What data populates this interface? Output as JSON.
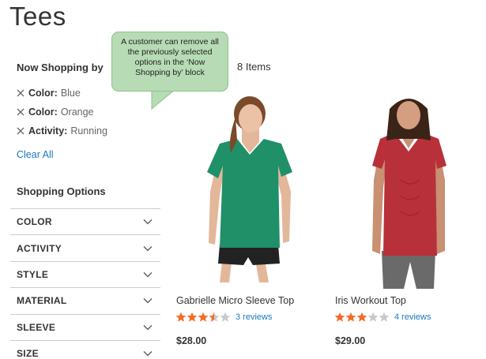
{
  "page": {
    "title": "Tees"
  },
  "now_shopping": {
    "title": "Now Shopping by",
    "filters": [
      {
        "name": "Color:",
        "value": "Blue"
      },
      {
        "name": "Color:",
        "value": "Orange"
      },
      {
        "name": "Activity:",
        "value": "Running"
      }
    ],
    "clear_all": "Clear All"
  },
  "shopping_options": {
    "title": "Shopping Options",
    "items": [
      "COLOR",
      "ACTIVITY",
      "STYLE",
      "MATERIAL",
      "SLEEVE",
      "SIZE"
    ]
  },
  "toolbar": {
    "count": "8 Items"
  },
  "callout": {
    "text": "A customer can remove all the previously selected options in the ‘Now Shopping by’ block"
  },
  "products": [
    {
      "name": "Gabrielle Micro Sleeve Top",
      "rating": 3.5,
      "reviews": "3 reviews",
      "price": "$28.00",
      "shirt_color": "#1f9068"
    },
    {
      "name": "Iris Workout Top",
      "rating": 3,
      "reviews": "4 reviews",
      "price": "$29.00",
      "shirt_color": "#b8303a"
    }
  ],
  "colors": {
    "link": "#1979c3",
    "star_on": "#f26c2b",
    "star_off": "#c9c9c9",
    "callout_bg": "#b7dcb5"
  }
}
